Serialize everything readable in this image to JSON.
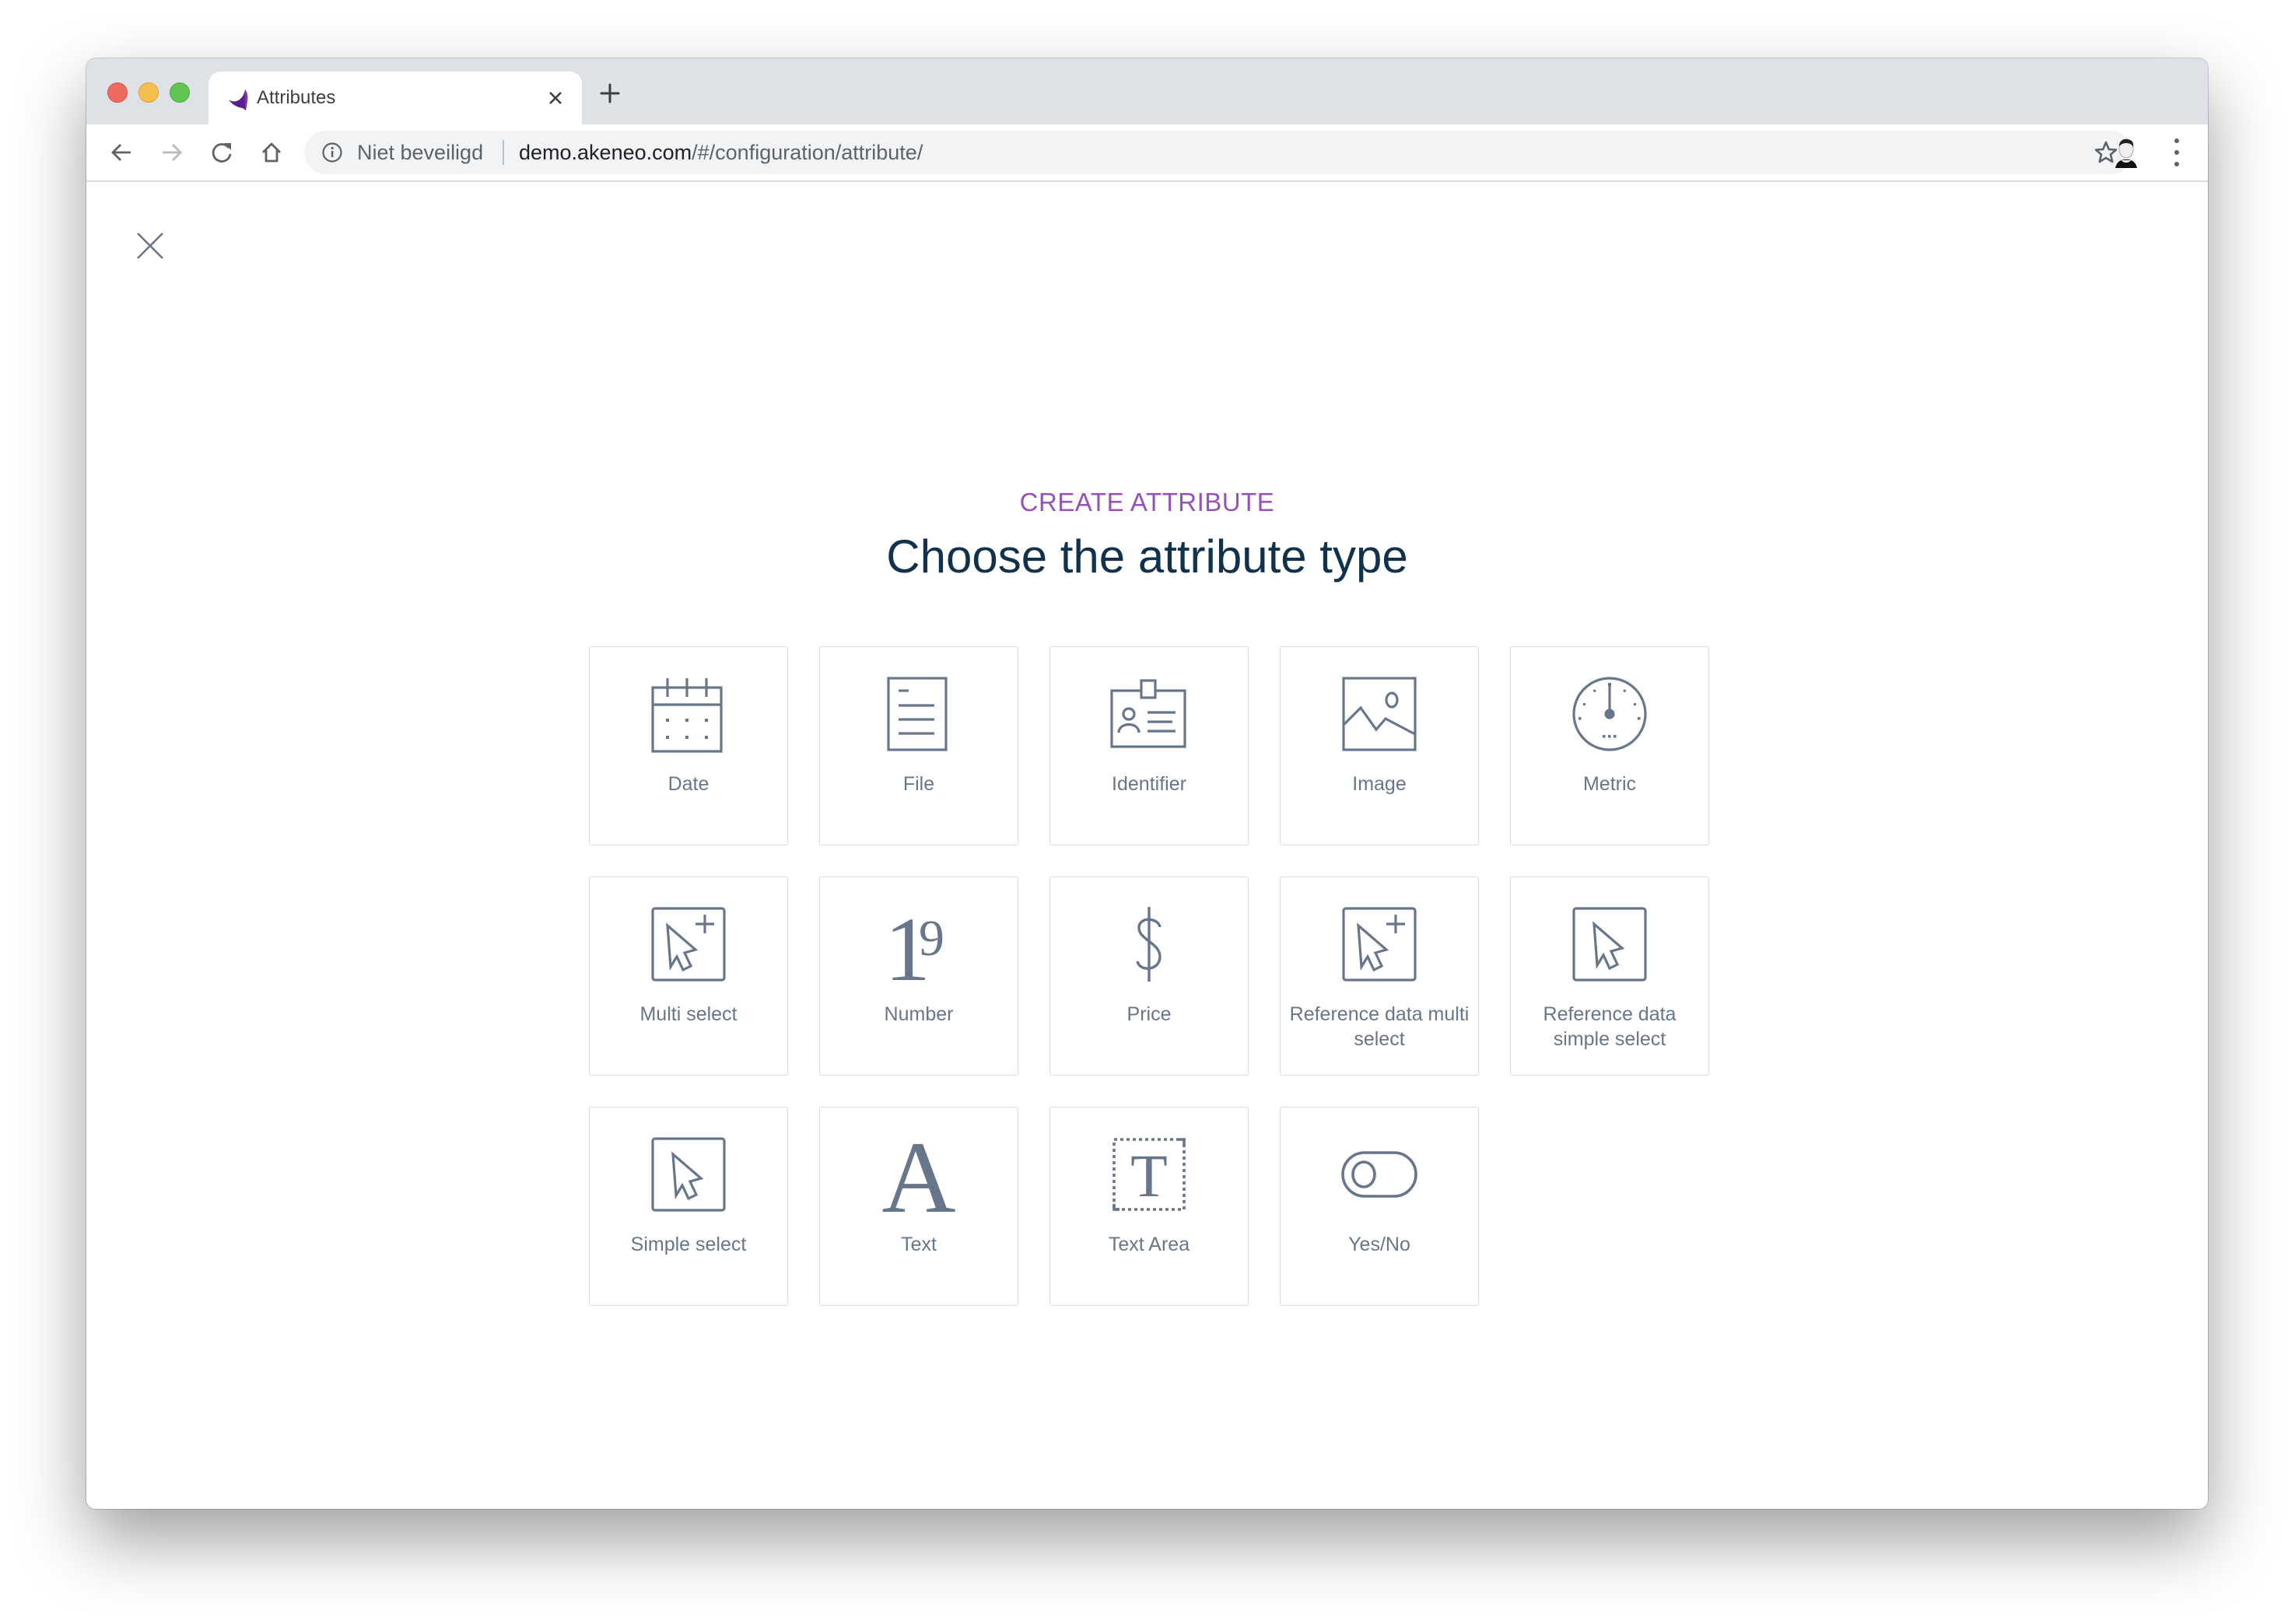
{
  "browser": {
    "tab": {
      "title": "Attributes",
      "favicon": "akeneo-logo-icon"
    },
    "omnibox": {
      "security_label": "Niet beveiligd",
      "url_host": "demo.akeneo.com",
      "url_path": "/#/configuration/attribute/"
    },
    "icons": {
      "back": "arrow-left-icon",
      "forward": "arrow-right-icon",
      "reload": "reload-icon",
      "home": "home-icon",
      "bookmark": "star-icon",
      "menu": "kebab-menu-icon"
    }
  },
  "page": {
    "eyebrow": "CREATE ATTRIBUTE",
    "title": "Choose the attribute type",
    "accent_color": "#9452ba",
    "title_color": "#11324d",
    "attribute_types": [
      {
        "label": "Date",
        "icon": "calendar-icon"
      },
      {
        "label": "File",
        "icon": "file-icon"
      },
      {
        "label": "Identifier",
        "icon": "id-badge-icon"
      },
      {
        "label": "Image",
        "icon": "image-icon"
      },
      {
        "label": "Metric",
        "icon": "gauge-icon"
      },
      {
        "label": "Multi select",
        "icon": "cursor-plus-icon"
      },
      {
        "label": "Number",
        "icon": "number-icon"
      },
      {
        "label": "Price",
        "icon": "dollar-icon"
      },
      {
        "label": "Reference data multi select",
        "icon": "cursor-plus-icon"
      },
      {
        "label": "Reference data simple select",
        "icon": "cursor-icon"
      },
      {
        "label": "Simple select",
        "icon": "cursor-icon"
      },
      {
        "label": "Text",
        "icon": "letter-a-icon"
      },
      {
        "label": "Text Area",
        "icon": "text-area-icon"
      },
      {
        "label": "Yes/No",
        "icon": "toggle-icon"
      }
    ]
  }
}
